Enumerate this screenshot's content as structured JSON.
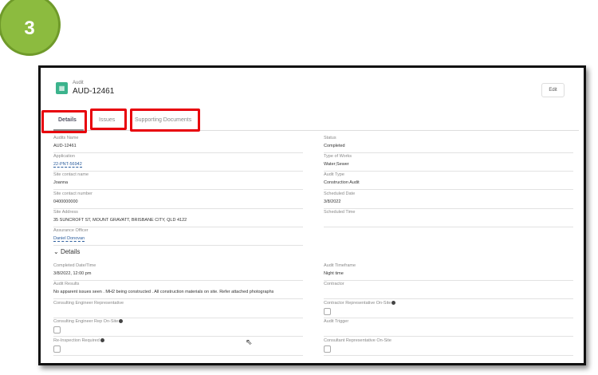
{
  "step_number": "3",
  "record": {
    "object_type": "Audit",
    "title": "AUD-12461",
    "icon": "audit-icon"
  },
  "edit_label": "Edit",
  "tabs": [
    {
      "label": "Details"
    },
    {
      "label": "Issues"
    },
    {
      "label": "Supporting Documents"
    }
  ],
  "left_fields": [
    {
      "label": "Audits Name",
      "value": "AUD-12461"
    },
    {
      "label": "Application",
      "value": "22-PNT-56942",
      "link": true
    },
    {
      "label": "Site contact name",
      "value": "Joanna"
    },
    {
      "label": "Site contact number",
      "value": "0400000000"
    },
    {
      "label": "Site Address",
      "value": "35 SUNCROFT ST, MOUNT GRAVATT, BRISBANE CITY, QLD 4122"
    },
    {
      "label": "Assurance Officer",
      "value": "Daniel Donovan",
      "link": true
    }
  ],
  "right_fields": [
    {
      "label": "Status",
      "value": "Completed"
    },
    {
      "label": "Type of Works",
      "value": "Water;Sewer"
    },
    {
      "label": "Audit Type",
      "value": "Construction Audit"
    },
    {
      "label": "Scheduled Date",
      "value": "3/8/2022"
    },
    {
      "label": "Scheduled Time",
      "value": ""
    }
  ],
  "details_section": {
    "title": "Details",
    "left_fields": [
      {
        "label": "Completed Date/Time",
        "value": "3/8/2022, 12:00 pm"
      },
      {
        "label": "Audit Results",
        "value": "No apparent issues seen . MH2 being constructed . All construction materials on site. Refer attached photographs"
      },
      {
        "label": "Consulting Engineer Representative",
        "value": ""
      },
      {
        "label": "Consulting Engineer Rep On-Site",
        "checkbox": true,
        "checked": false,
        "info": true
      },
      {
        "label": "Re-Inspection Required",
        "checkbox": true,
        "checked": false,
        "info": true
      }
    ],
    "right_fields": [
      {
        "label": "Audit Timeframe",
        "value": "Night time"
      },
      {
        "label": "Contractor",
        "value": ""
      },
      {
        "label": "Contractor Representative On-Site",
        "checkbox": true,
        "checked": false,
        "info": true
      },
      {
        "label": "Audit Trigger",
        "value": ""
      },
      {
        "label": "Consultant Representative On-Site",
        "checkbox": true,
        "checked": false
      }
    ]
  }
}
